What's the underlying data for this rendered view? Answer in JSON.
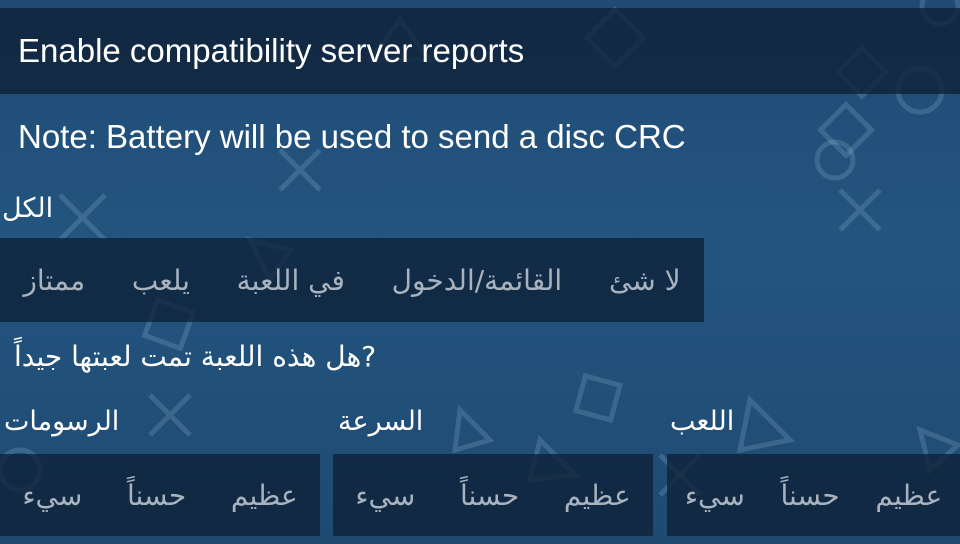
{
  "header": {
    "label": "Enable compatibility server reports"
  },
  "note": {
    "text": "Note: Battery will be used to send a disc CRC"
  },
  "overall": {
    "label": "الكل",
    "options": [
      "ممتاز",
      "يلعب",
      "في اللعبة",
      "القائمة/الدخول",
      "لا شئ"
    ]
  },
  "question": {
    "text": "هل هذه اللعبة تمت لعبتها جيداً?"
  },
  "graphics": {
    "label": "الرسومات",
    "options": [
      "سيء",
      "حسناً",
      "عظيم"
    ]
  },
  "speed": {
    "label": "السرعة",
    "options": [
      "سيء",
      "حسناً",
      "عظيم"
    ]
  },
  "gameplay": {
    "label": "اللعب",
    "options": [
      "سيء",
      "حسناً",
      "عظيم"
    ]
  },
  "colors": {
    "panel": "#0e2036",
    "background": "#23557f",
    "option_text": "#a8b3bf"
  }
}
